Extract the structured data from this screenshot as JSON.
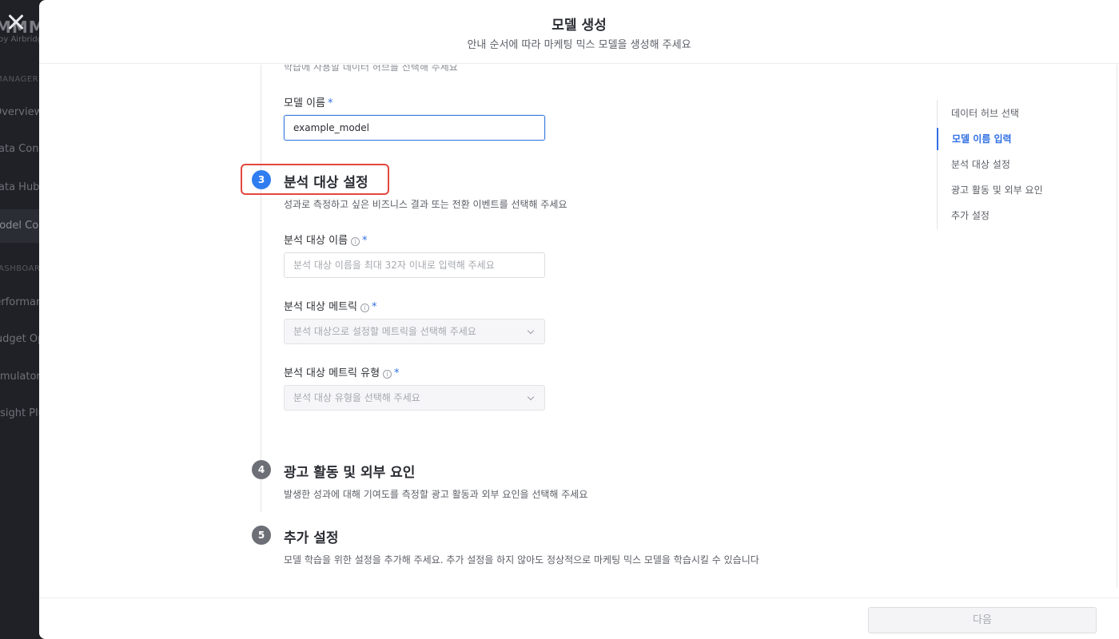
{
  "background_app": {
    "logo": "MMM",
    "logo_sub": "by Airbridge",
    "sections": [
      "MANAGER",
      "DASHBOARD"
    ],
    "items": [
      "Overview",
      "Data Connect",
      "Data Hub",
      "Model Config",
      "Performance",
      "Budget Opt",
      "Simulator",
      "Insight Plus"
    ]
  },
  "modal": {
    "title": "모델 생성",
    "subtitle": "안내 순서에 따라 마케팅 믹스 모델을 생성해 주세요",
    "cut_text": "학습에 사용할 데이터 허브를 선택해 주세요"
  },
  "form": {
    "model_name": {
      "label": "모델 이름",
      "required": "*",
      "value": "example_model"
    },
    "step3": {
      "number": "3",
      "title": "분석 대상 설정",
      "desc": "성과로 측정하고 싶은 비즈니스 결과 또는 전환 이벤트를 선택해 주세요",
      "target_name": {
        "label": "분석 대상 이름",
        "required": "*",
        "info": "i",
        "placeholder": "분석 대상 이름을 최대 32자 이내로 입력해 주세요"
      },
      "target_metric": {
        "label": "분석 대상 메트릭",
        "required": "*",
        "info": "i",
        "placeholder": "분석 대상으로 설정할 메트릭을 선택해 주세요"
      },
      "target_metric_type": {
        "label": "분석 대상 메트릭 유형",
        "required": "*",
        "info": "i",
        "placeholder": "분석 대상 유형을 선택해 주세요"
      }
    },
    "step4": {
      "number": "4",
      "title": "광고 활동 및 외부 요인",
      "desc": "발생한 성과에 대해 기여도를 측정할 광고 활동과 외부 요인을 선택해 주세요"
    },
    "step5": {
      "number": "5",
      "title": "추가 설정",
      "desc": "모델 학습을 위한 설정을 추가해 주세요. 추가 설정을 하지 않아도 정상적으로 마케팅 믹스 모델을 학습시킬 수 있습니다"
    }
  },
  "right_nav": {
    "items": [
      "데이터 허브 선택",
      "모델 이름 입력",
      "분석 대상 설정",
      "광고 활동 및 외부 요인",
      "추가 설정"
    ],
    "active_index": 1
  },
  "footer": {
    "next_label": "다음"
  },
  "colors": {
    "accent": "#2f6fe4",
    "step_active": "#2f7df0",
    "highlight": "#e2483e"
  }
}
